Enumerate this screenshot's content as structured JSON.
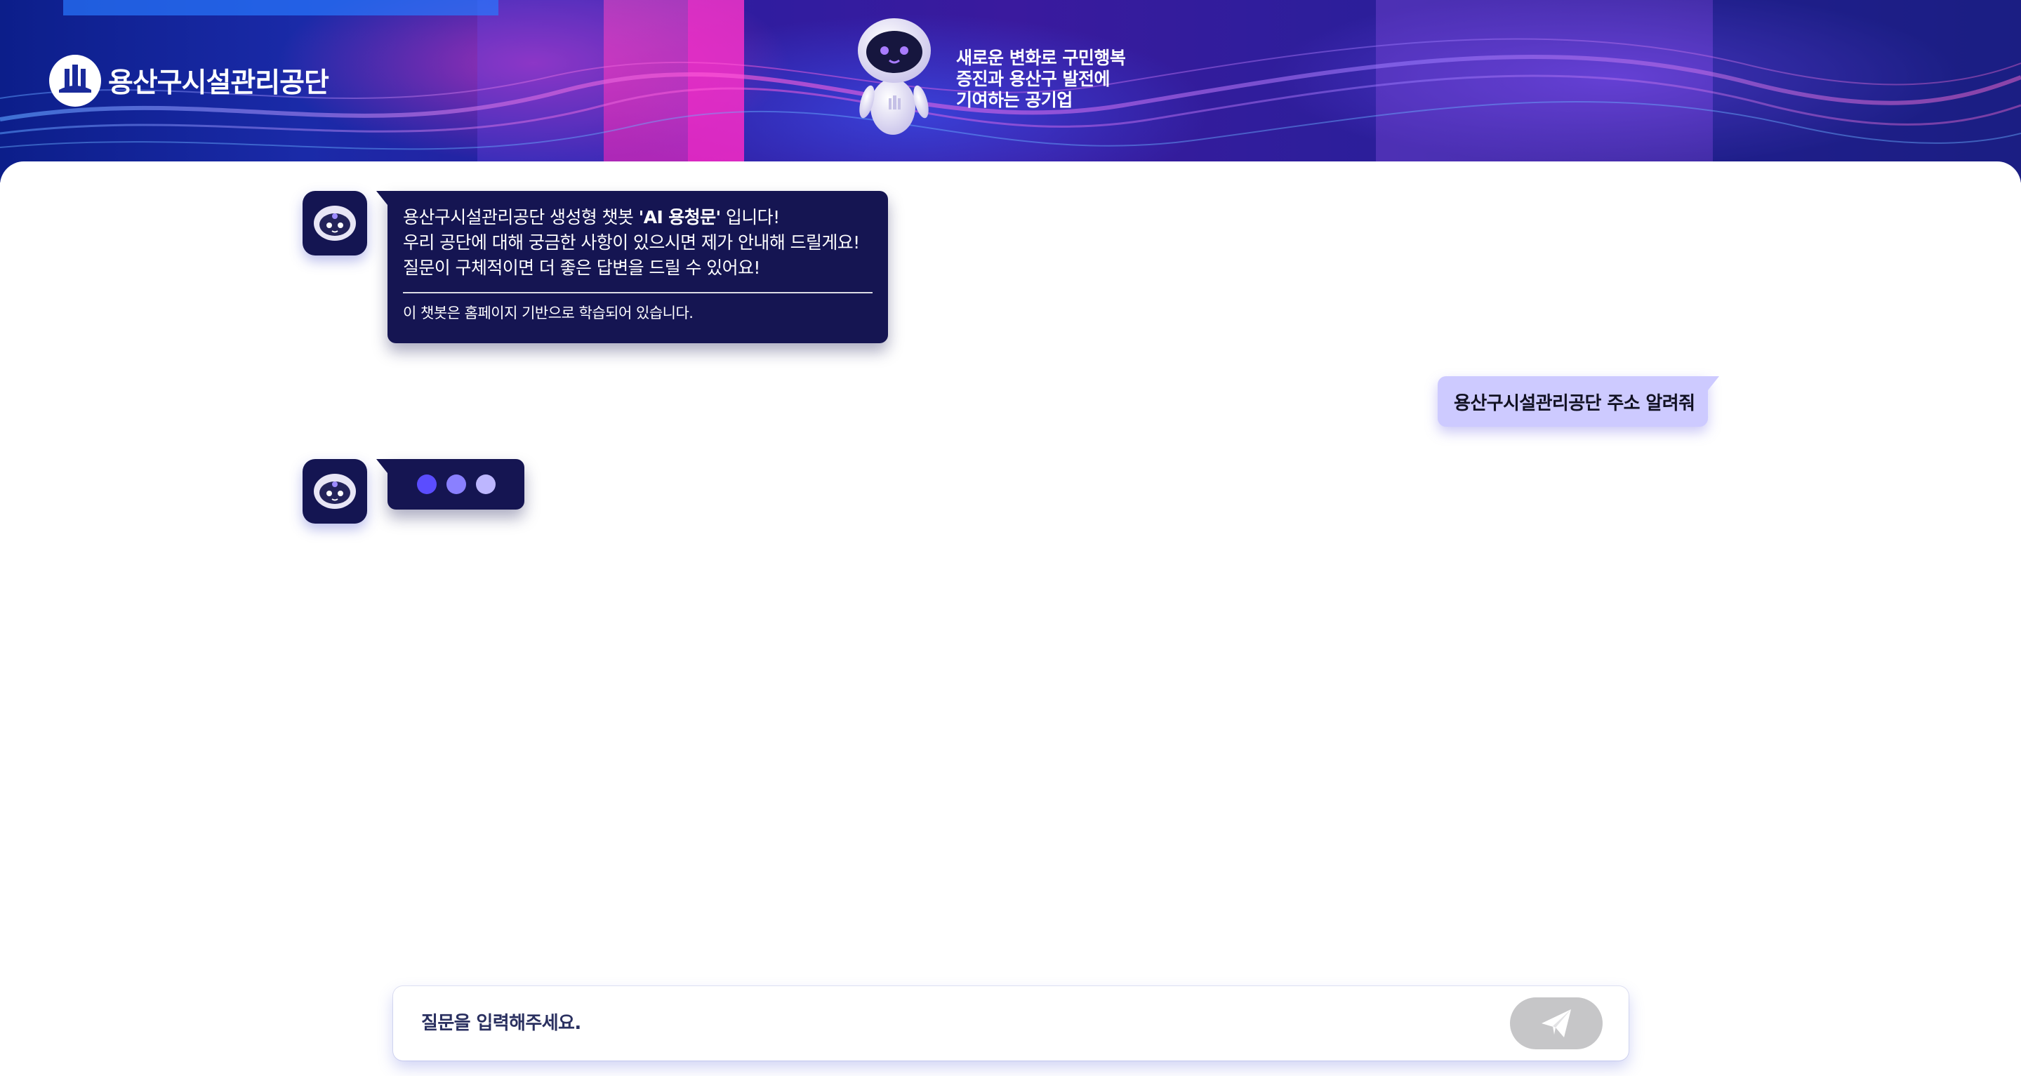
{
  "header": {
    "org_name": "용산구시설관리공단",
    "slogan": [
      "새로운 변화로 구민행복",
      "증진과 용산구 발전에",
      "기여하는 공기업"
    ]
  },
  "chat": {
    "welcome": {
      "line1_prefix": "용산구시설관리공단 생성형 챗봇 ",
      "bot_name": "'AI 용청문'",
      "line1_suffix": " 입니다!",
      "line2": "우리 공단에 대해 궁금한 사항이 있으시면 제가 안내해 드릴게요!",
      "line3": "질문이 구체적이면 더 좋은 답변을 드릴 수 있어요!",
      "note": "이 챗봇은 홈페이지 기반으로 학습되어 있습니다."
    },
    "user_message": "용산구시설관리공단 주소 알려줘",
    "typing_indicator": true
  },
  "input": {
    "placeholder": "질문을 입력해주세요.",
    "value": ""
  },
  "colors": {
    "bot_bubble": "#151552",
    "user_bubble": "#cdcaff",
    "send_button": "#c6c6c8",
    "typing_dots": [
      "#5b4dff",
      "#8a80ff",
      "#bdb6ff"
    ]
  },
  "icons": {
    "logo": "gongdan-logo-icon",
    "mascot": "robot-mascot-icon",
    "bot_avatar": "bot-face-icon",
    "send": "paper-plane-icon"
  }
}
